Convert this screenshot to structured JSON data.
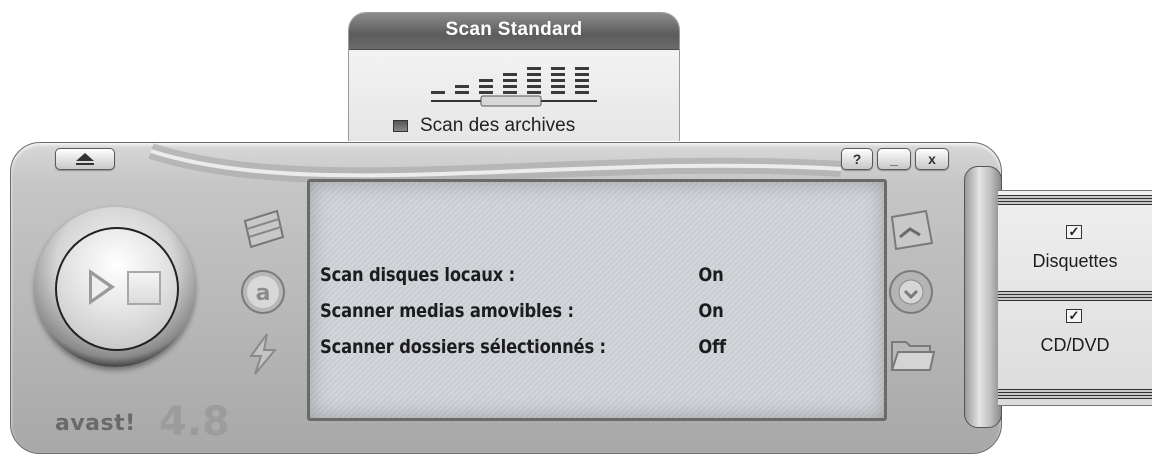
{
  "scan_panel": {
    "title": "Scan Standard",
    "sensitivity_level": 4,
    "sensitivity_max": 7,
    "archives_label": "Scan des archives",
    "archives_checked": true
  },
  "window_buttons": {
    "eject_icon": "eject-icon",
    "help_label": "?",
    "minimize_label": "_",
    "close_label": "x"
  },
  "lcd": {
    "rows": [
      {
        "label": "Scan disques locaux :",
        "value": "On"
      },
      {
        "label": "Scanner medias amovibles :",
        "value": "On"
      },
      {
        "label": "Scanner dossiers sélectionnés :",
        "value": "Off"
      }
    ]
  },
  "left_buttons": [
    "database-icon",
    "avast-a-icon",
    "lightning-icon"
  ],
  "right_buttons": [
    "mail-scan-icon",
    "shield-disc-icon",
    "folder-icon"
  ],
  "brand": {
    "logo": "avast!",
    "version": "4.8"
  },
  "drives": [
    {
      "label": "Disquettes",
      "checked": true
    },
    {
      "label": "CD/DVD",
      "checked": true
    }
  ],
  "colors": {
    "lcd_text": "#1c1c1c",
    "chrome": "#c6c6c6"
  }
}
